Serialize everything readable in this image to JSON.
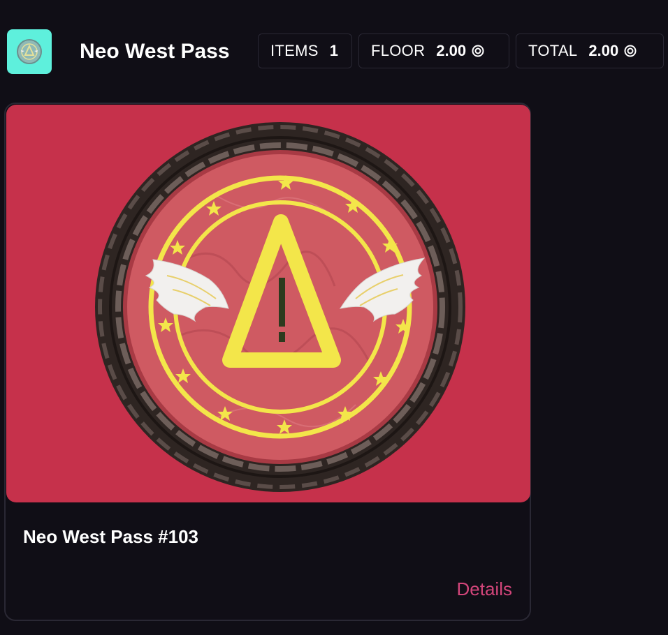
{
  "header": {
    "collection_logo_icon": "coin-logo-icon",
    "title": "Neo West Pass",
    "stats": {
      "items": {
        "label": "ITEMS",
        "value": "1"
      },
      "floor": {
        "label": "FLOOR",
        "value": "2.00",
        "currency_icon": "currency-icon"
      },
      "total": {
        "label": "TOTAL",
        "value": "2.00",
        "currency_icon": "currency-icon"
      }
    }
  },
  "card": {
    "image_icon": "neo-west-pass-coin-icon",
    "title": "Neo West Pass #103",
    "details_label": "Details"
  },
  "colors": {
    "background": "#100e16",
    "logo_bg": "#5ef0dc",
    "card_image_bg": "#c6314b",
    "coin_yellow": "#f3e64a",
    "link": "#d2457a"
  }
}
